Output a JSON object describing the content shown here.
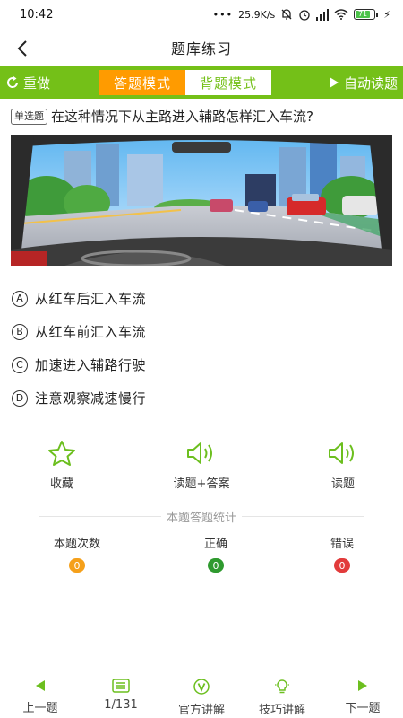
{
  "status_bar": {
    "time": "10:42",
    "network_speed": "25.9K/s",
    "battery_level": "71"
  },
  "header": {
    "title": "题库练习",
    "back_icon": "chevron-left-icon"
  },
  "mode_bar": {
    "redo_label": "重做",
    "tabs": [
      {
        "label": "答题模式",
        "active": true
      },
      {
        "label": "背题模式",
        "active": false
      }
    ],
    "auto_read_label": "自动读题",
    "accent_color": "#74c018",
    "active_color": "#ff9b00"
  },
  "question": {
    "type_label": "单选题",
    "text": "在这种情况下从主路进入辅路怎样汇入车流?"
  },
  "options": [
    {
      "letter": "A",
      "text": "从红车后汇入车流"
    },
    {
      "letter": "B",
      "text": "从红车前汇入车流"
    },
    {
      "letter": "C",
      "text": "加速进入辅路行驶"
    },
    {
      "letter": "D",
      "text": "注意观察减速慢行"
    }
  ],
  "actions": [
    {
      "label": "收藏",
      "icon": "star-icon"
    },
    {
      "label": "读题+答案",
      "icon": "speaker-icon"
    },
    {
      "label": "读题",
      "icon": "speaker-icon"
    }
  ],
  "stats": {
    "title": "本题答题统计",
    "items": [
      {
        "label": "本题次数",
        "value": "0",
        "color": "#f5a01a"
      },
      {
        "label": "正确",
        "value": "0",
        "color": "#2f9a2f"
      },
      {
        "label": "错误",
        "value": "0",
        "color": "#e23b3b"
      }
    ]
  },
  "bottom_nav": [
    {
      "label": "上一题",
      "icon": "triangle-left-icon"
    },
    {
      "label": "1/131",
      "icon": "list-icon"
    },
    {
      "label": "官方讲解",
      "icon": "v-badge-icon"
    },
    {
      "label": "技巧讲解",
      "icon": "lightbulb-icon"
    },
    {
      "label": "下一题",
      "icon": "triangle-right-icon"
    }
  ]
}
